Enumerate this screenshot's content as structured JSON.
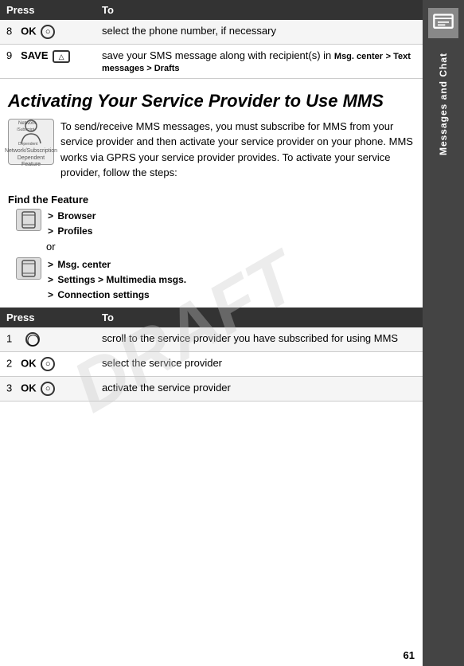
{
  "sidebar": {
    "text": "Messages and Chat"
  },
  "top_table": {
    "headers": [
      "Press",
      "To"
    ],
    "rows": [
      {
        "num": "8",
        "key": "OK",
        "key_has_circle": true,
        "to": "select the phone number, if necessary"
      },
      {
        "num": "9",
        "key": "SAVE",
        "key_has_rect": true,
        "to_parts": [
          {
            "text": "save your SMS message along with recipient(s) in ",
            "bold": false
          },
          {
            "text": "Msg. center",
            "bold": true
          },
          {
            "text": " > ",
            "bold": true
          },
          {
            "text": "Text messages",
            "bold": true
          },
          {
            "text": " > ",
            "bold": true
          },
          {
            "text": "Drafts",
            "bold": true
          }
        ]
      }
    ]
  },
  "section_title": "Activating Your Service Provider to Use MMS",
  "body_text": "To send/receive MMS messages, you must subscribe for MMS from your service provider and then activate your service provider on your phone. MMS works via GPRS your service provider provides. To activate your service provider, follow the steps:",
  "find_feature": {
    "label": "Find the Feature",
    "path1": {
      "steps": [
        "> Browser",
        "> Profiles"
      ]
    },
    "or": "or",
    "path2": {
      "steps": [
        "> Msg. center",
        "> Settings >",
        "Multimedia msgs.",
        "> Connection settings"
      ]
    }
  },
  "bottom_table": {
    "headers": [
      "Press",
      "To"
    ],
    "rows": [
      {
        "num": "1",
        "key_type": "scroll",
        "to": "scroll to the service provider you have subscribed for using MMS"
      },
      {
        "num": "2",
        "key": "OK",
        "key_has_circle": true,
        "to": "select the service provider"
      },
      {
        "num": "3",
        "key": "OK",
        "key_has_circle": true,
        "to": "activate the service provider"
      }
    ]
  },
  "page_number": "61",
  "draft_watermark": "DRAFT"
}
